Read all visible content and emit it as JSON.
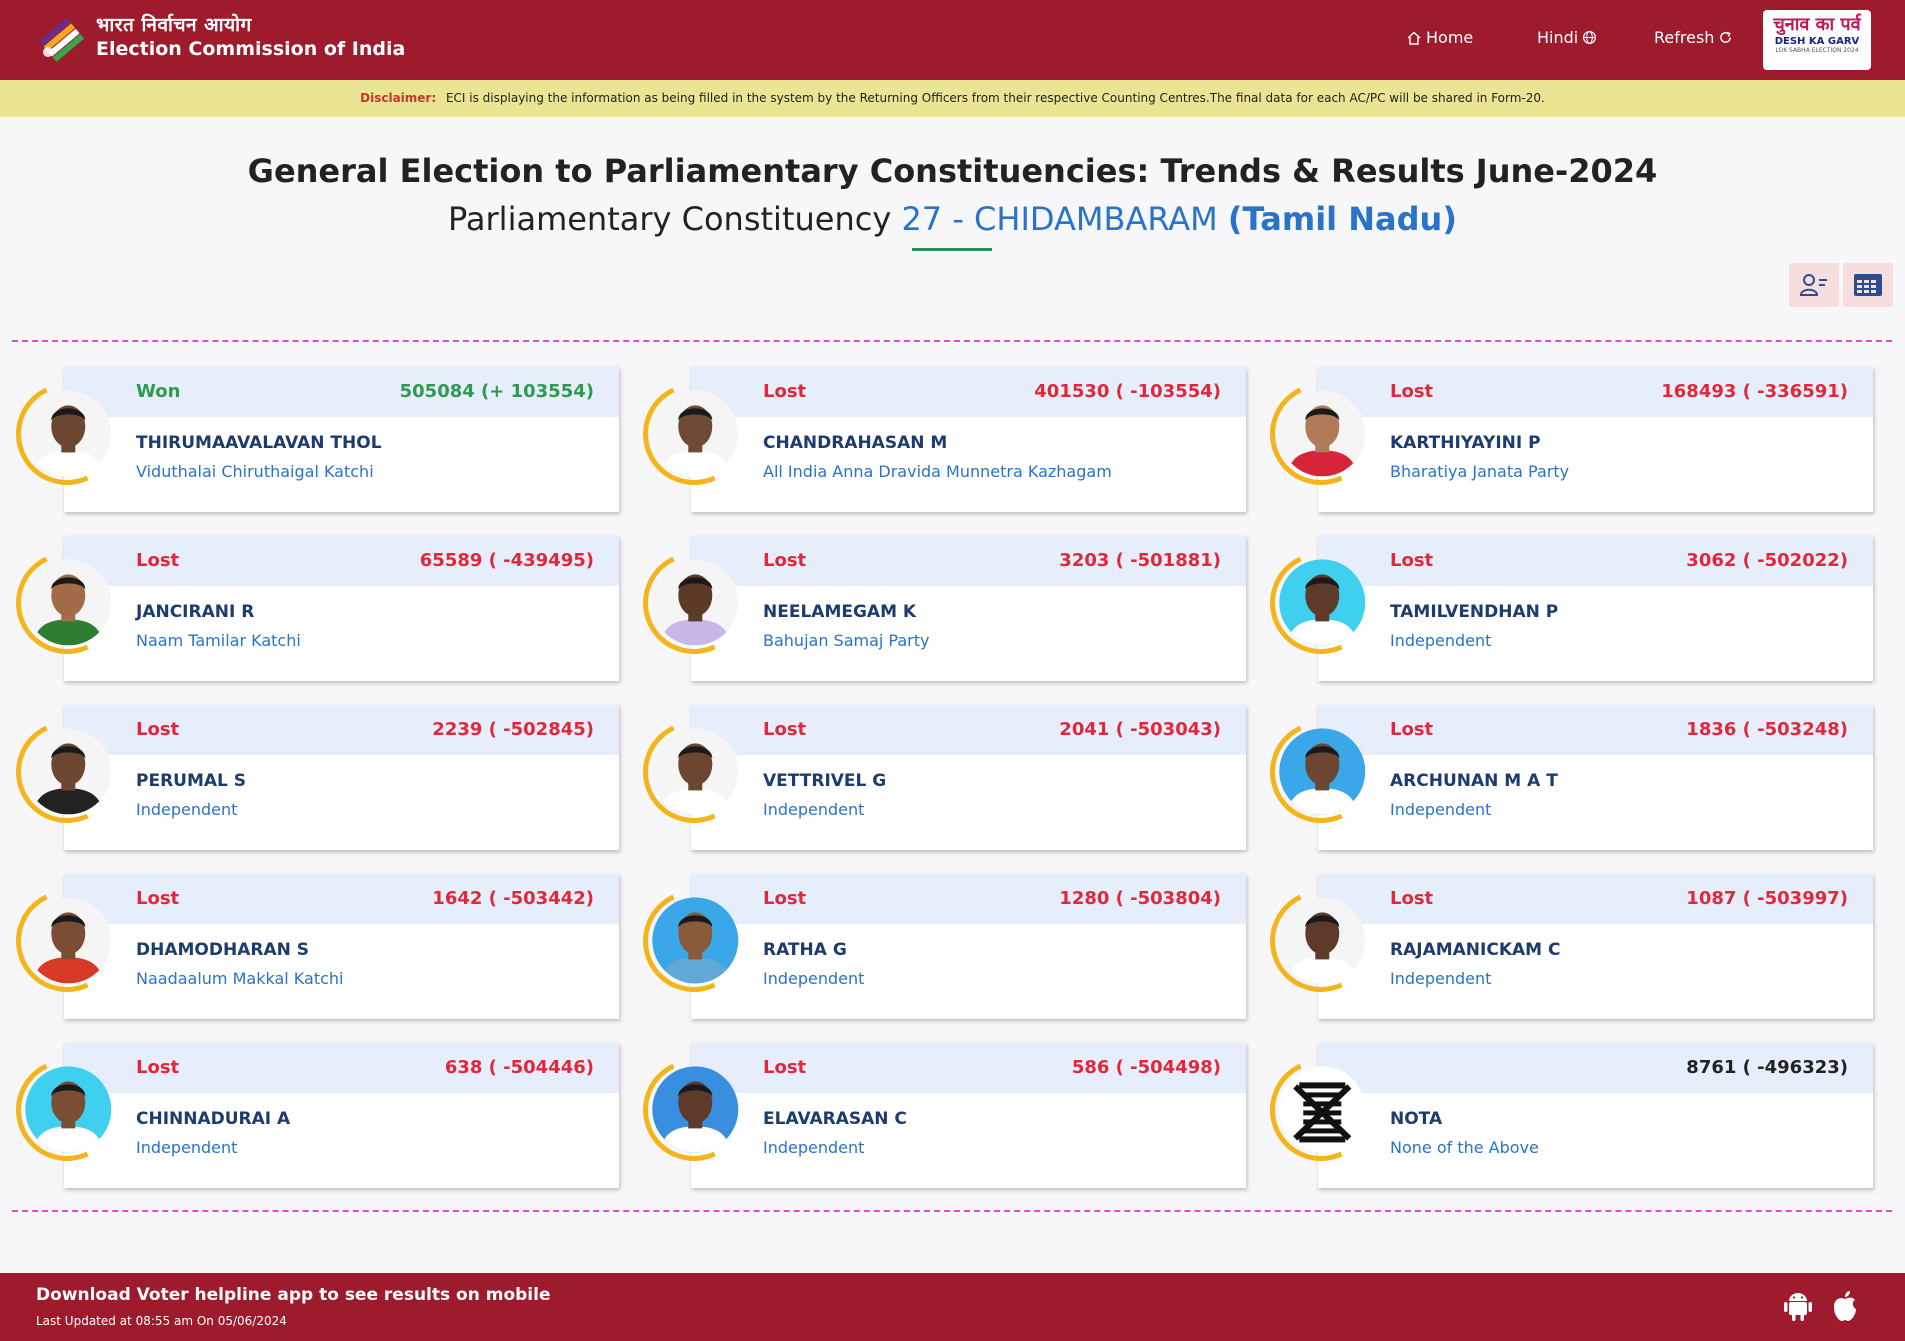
{
  "header": {
    "brand_hindi": "भारत निर्वाचन आयोग",
    "brand_english": "Election Commission of India",
    "nav_home": "Home",
    "nav_hindi": "Hindi",
    "nav_refresh": "Refresh",
    "logo_hindi": "चुनाव का पर्व",
    "logo_english": "DESH KA GARV",
    "logo_sub": "LOK SABHA ELECTION 2024"
  },
  "disclaimer": {
    "label": "Disclaimer:",
    "text": "ECI is displaying the information as being filled in the system by the Returning Officers from their respective Counting Centres.The final data for each AC/PC will be shared in Form-20."
  },
  "page": {
    "title": "General Election to Parliamentary Constituencies: Trends & Results June-2024",
    "subtitle_prefix": "Parliamentary Constituency",
    "constituency": "27 - CHIDAMBARAM",
    "state": "(Tamil Nadu)"
  },
  "candidates": [
    {
      "status": "Won",
      "votes": "505084 (+ 103554)",
      "name": "THIRUMAAVALAVAN THOL",
      "party": "Viduthalai Chiruthaigal Katchi",
      "skin": "#6b4630",
      "bg": "#f5f5f5",
      "shirt": "#ffffff"
    },
    {
      "status": "Lost",
      "votes": "401530 ( -103554)",
      "name": "CHANDRAHASAN M",
      "party": "All India Anna Dravida Munnetra Kazhagam",
      "skin": "#6e4a34",
      "bg": "#f5f5f5",
      "shirt": "#ffffff"
    },
    {
      "status": "Lost",
      "votes": "168493 ( -336591)",
      "name": "KARTHIYAYINI P",
      "party": "Bharatiya Janata Party",
      "skin": "#b07a58",
      "bg": "#f5f5f5",
      "shirt": "#d6243a"
    },
    {
      "status": "Lost",
      "votes": "65589 ( -439495)",
      "name": "JANCIRANI R",
      "party": "Naam Tamilar Katchi",
      "skin": "#a36b47",
      "bg": "#f5f5f5",
      "shirt": "#2e7d32"
    },
    {
      "status": "Lost",
      "votes": "3203 ( -501881)",
      "name": "NEELAMEGAM K",
      "party": "Bahujan Samaj Party",
      "skin": "#5b3a26",
      "bg": "#f5f5f5",
      "shirt": "#c9b7e8"
    },
    {
      "status": "Lost",
      "votes": "3062 ( -502022)",
      "name": "TAMILVENDHAN P",
      "party": "Independent",
      "skin": "#5e3b28",
      "bg": "#3fd0ef",
      "shirt": "#ffffff"
    },
    {
      "status": "Lost",
      "votes": "2239 ( -502845)",
      "name": "PERUMAL S",
      "party": "Independent",
      "skin": "#6b4630",
      "bg": "#f5f5f5",
      "shirt": "#222222"
    },
    {
      "status": "Lost",
      "votes": "2041 ( -503043)",
      "name": "VETTRIVEL G",
      "party": "Independent",
      "skin": "#6b4630",
      "bg": "#f5f5f5",
      "shirt": "#ffffff"
    },
    {
      "status": "Lost",
      "votes": "1836 ( -503248)",
      "name": "ARCHUNAN M A T",
      "party": "Independent",
      "skin": "#6b4630",
      "bg": "#3aa8e8",
      "shirt": "#ffffff"
    },
    {
      "status": "Lost",
      "votes": "1642 ( -503442)",
      "name": "DHAMODHARAN S",
      "party": "Naadaalum Makkal Katchi",
      "skin": "#7a4e34",
      "bg": "#f5f5f5",
      "shirt": "#d83a2a"
    },
    {
      "status": "Lost",
      "votes": "1280 ( -503804)",
      "name": "RATHA G",
      "party": "Independent",
      "skin": "#8a5a3c",
      "bg": "#3aa8e8",
      "shirt": "#5fa8d8"
    },
    {
      "status": "Lost",
      "votes": "1087 ( -503997)",
      "name": "RAJAMANICKAM C",
      "party": "Independent",
      "skin": "#5e3b28",
      "bg": "#f5f5f5",
      "shirt": "#ffffff"
    },
    {
      "status": "Lost",
      "votes": "638 ( -504446)",
      "name": "CHINNADURAI A",
      "party": "Independent",
      "skin": "#7a4e34",
      "bg": "#3fd0ef",
      "shirt": "#ffffff"
    },
    {
      "status": "Lost",
      "votes": "586 ( -504498)",
      "name": "ELAVARASAN C",
      "party": "Independent",
      "skin": "#5e3b28",
      "bg": "#3a8ee0",
      "shirt": "#ffffff"
    },
    {
      "status": "",
      "votes": "8761 ( -496323)",
      "name": "NOTA",
      "party": "None of the Above",
      "skin": "",
      "bg": "#ffffff",
      "shirt": "",
      "nota": true
    }
  ],
  "footer": {
    "download": "Download Voter helpline app to see results on mobile",
    "updated": "Last Updated at 08:55 am On 05/06/2024"
  },
  "colors": {
    "header_bg": "#9e1a2d",
    "won": "#2e9a4f",
    "lost": "#e0283a",
    "party_blue": "#2a73c7",
    "ring": "#f4b51c"
  }
}
